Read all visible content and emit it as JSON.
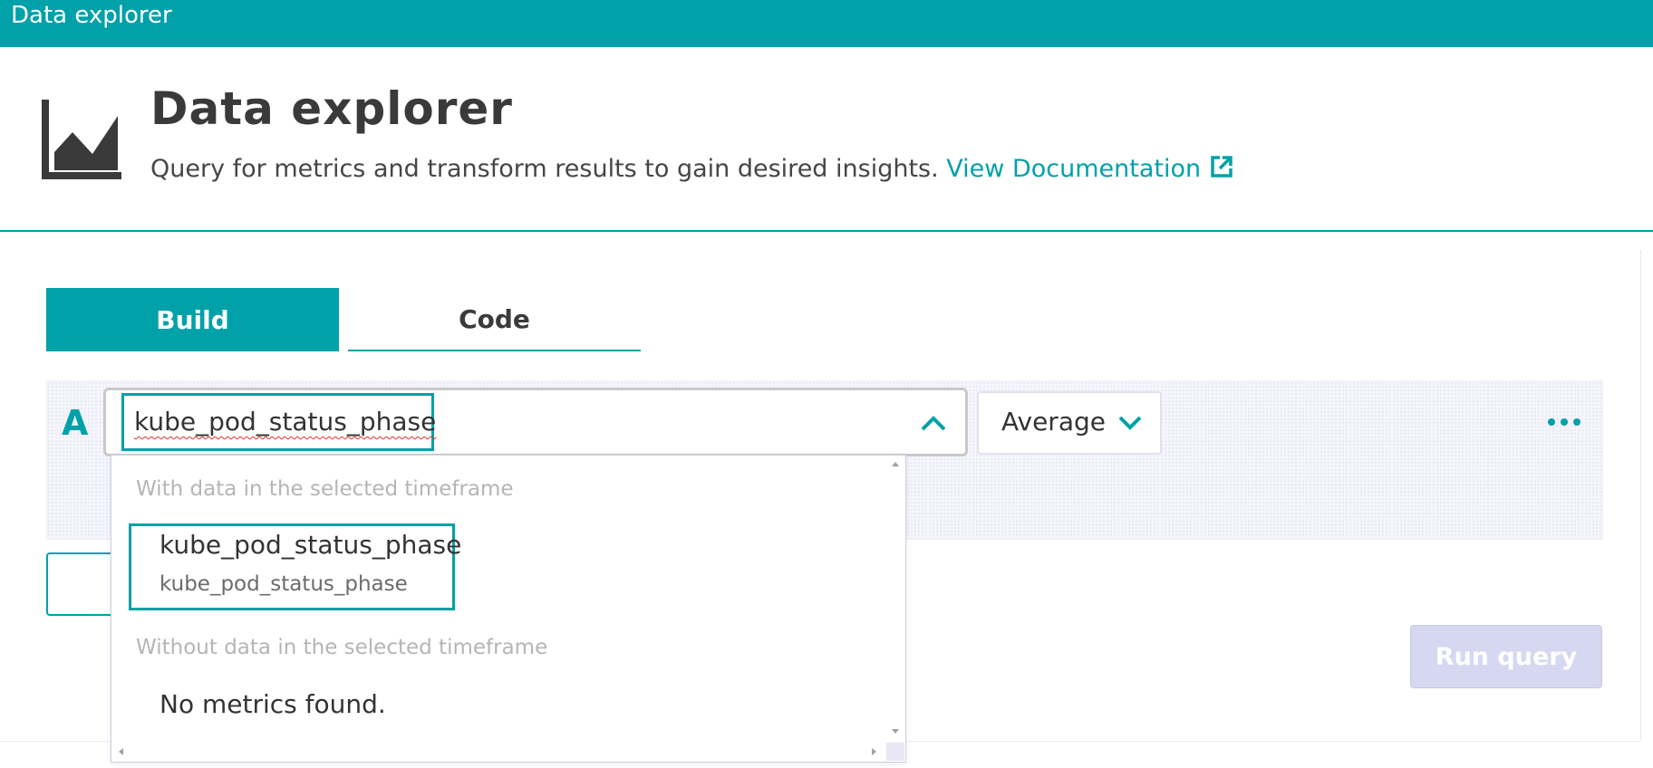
{
  "window": {
    "title": "Data explorer"
  },
  "header": {
    "icon": "area-chart-icon",
    "title": "Data explorer",
    "description": "Query for metrics and transform results to gain desired insights.",
    "doc_link": "View Documentation",
    "doc_link_icon": "external-link-icon"
  },
  "tabs": [
    {
      "label": "Build",
      "active": true
    },
    {
      "label": "Code",
      "active": false
    }
  ],
  "query": {
    "letter": "A",
    "metric_value": "kube_pod_status_phase",
    "aggregation": "Average",
    "more_icon": "more-horizontal-icon"
  },
  "dropdown": {
    "group_with_data": "With data in the selected timeframe",
    "items": [
      {
        "title": "kube_pod_status_phase",
        "subtitle": "kube_pod_status_phase"
      }
    ],
    "group_without_data": "Without data in the selected timeframe",
    "empty_message": "No metrics found."
  },
  "actions": {
    "run_query": "Run query"
  },
  "colors": {
    "accent": "#00a1a8",
    "run_disabled": "#d6d7f0",
    "panel": "#f5f5fc"
  }
}
